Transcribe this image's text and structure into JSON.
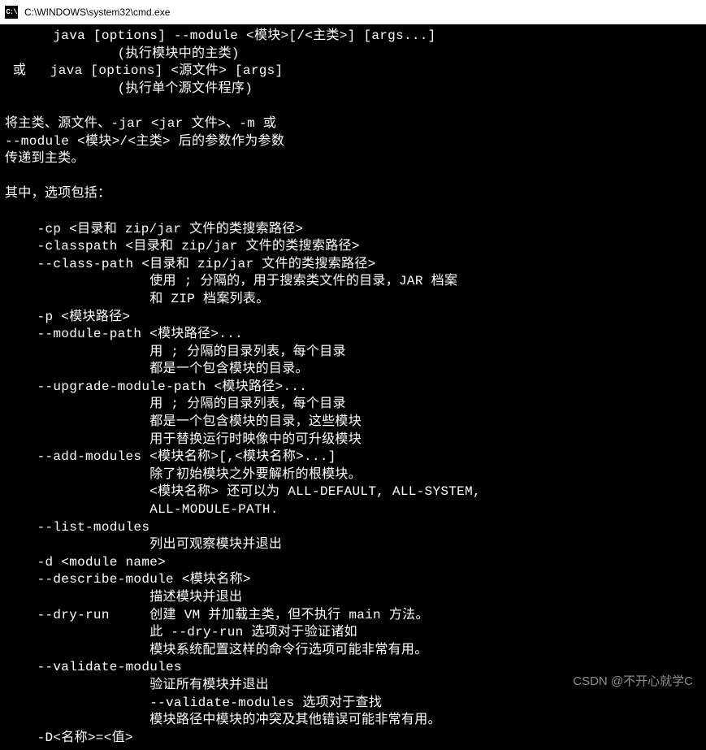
{
  "window": {
    "icon_label": "C:\\",
    "title": "C:\\WINDOWS\\system32\\cmd.exe"
  },
  "terminal": {
    "lines": [
      "      java [options] --module <模块>[/<主类>] [args...]",
      "              (执行模块中的主类)",
      " 或   java [options] <源文件> [args]",
      "              (执行单个源文件程序)",
      "",
      "将主类、源文件、-jar <jar 文件>、-m 或",
      "--module <模块>/<主类> 后的参数作为参数",
      "传递到主类。",
      "",
      "其中，选项包括：",
      "",
      "    -cp <目录和 zip/jar 文件的类搜索路径>",
      "    -classpath <目录和 zip/jar 文件的类搜索路径>",
      "    --class-path <目录和 zip/jar 文件的类搜索路径>",
      "                  使用 ; 分隔的，用于搜索类文件的目录，JAR 档案",
      "                  和 ZIP 档案列表。",
      "    -p <模块路径>",
      "    --module-path <模块路径>...",
      "                  用 ; 分隔的目录列表，每个目录",
      "                  都是一个包含模块的目录。",
      "    --upgrade-module-path <模块路径>...",
      "                  用 ; 分隔的目录列表，每个目录",
      "                  都是一个包含模块的目录，这些模块",
      "                  用于替换运行时映像中的可升级模块",
      "    --add-modules <模块名称>[,<模块名称>...]",
      "                  除了初始模块之外要解析的根模块。",
      "                  <模块名称> 还可以为 ALL-DEFAULT, ALL-SYSTEM,",
      "                  ALL-MODULE-PATH.",
      "    --list-modules",
      "                  列出可观察模块并退出",
      "    -d <module name>",
      "    --describe-module <模块名称>",
      "                  描述模块并退出",
      "    --dry-run     创建 VM 并加载主类，但不执行 main 方法。",
      "                  此 --dry-run 选项对于验证诸如",
      "                  模块系统配置这样的命令行选项可能非常有用。",
      "    --validate-modules",
      "                  验证所有模块并退出",
      "                  --validate-modules 选项对于查找",
      "                  模块路径中模块的冲突及其他错误可能非常有用。",
      "    -D<名称>=<值>"
    ]
  },
  "watermark": {
    "text": "CSDN @不开心就学C"
  }
}
